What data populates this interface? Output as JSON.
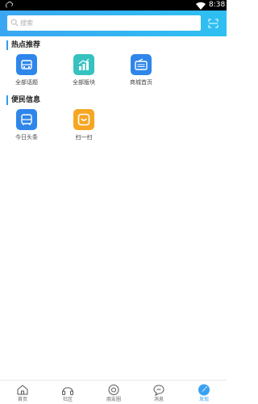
{
  "status_bar": {
    "time": "8:38"
  },
  "search": {
    "placeholder": "搜索"
  },
  "sections": [
    {
      "title": "热点推荐",
      "items": [
        {
          "label": "全部话题",
          "icon": "topic-icon",
          "color": "#2f86ea"
        },
        {
          "label": "全部版块",
          "icon": "chart-icon",
          "color": "#35c2c0"
        },
        {
          "label": "商城首页",
          "icon": "radio-icon",
          "color": "#2f86ea"
        }
      ]
    },
    {
      "title": "便民信息",
      "items": [
        {
          "label": "今日头条",
          "icon": "bus-icon",
          "color": "#2f86ea"
        },
        {
          "label": "扫一扫",
          "icon": "scan-smile-icon",
          "color": "#f6a623"
        }
      ]
    }
  ],
  "tabbar": {
    "items": [
      {
        "label": "首页",
        "icon": "home-icon"
      },
      {
        "label": "社区",
        "icon": "community-icon"
      },
      {
        "label": "朋友圈",
        "icon": "moments-icon"
      },
      {
        "label": "消息",
        "icon": "message-icon"
      },
      {
        "label": "发现",
        "icon": "rocket-icon",
        "active": true
      }
    ]
  },
  "colors": {
    "accent": "#3aa2f2",
    "header_start": "#3aa6f2",
    "header_end": "#2ec0f2"
  }
}
